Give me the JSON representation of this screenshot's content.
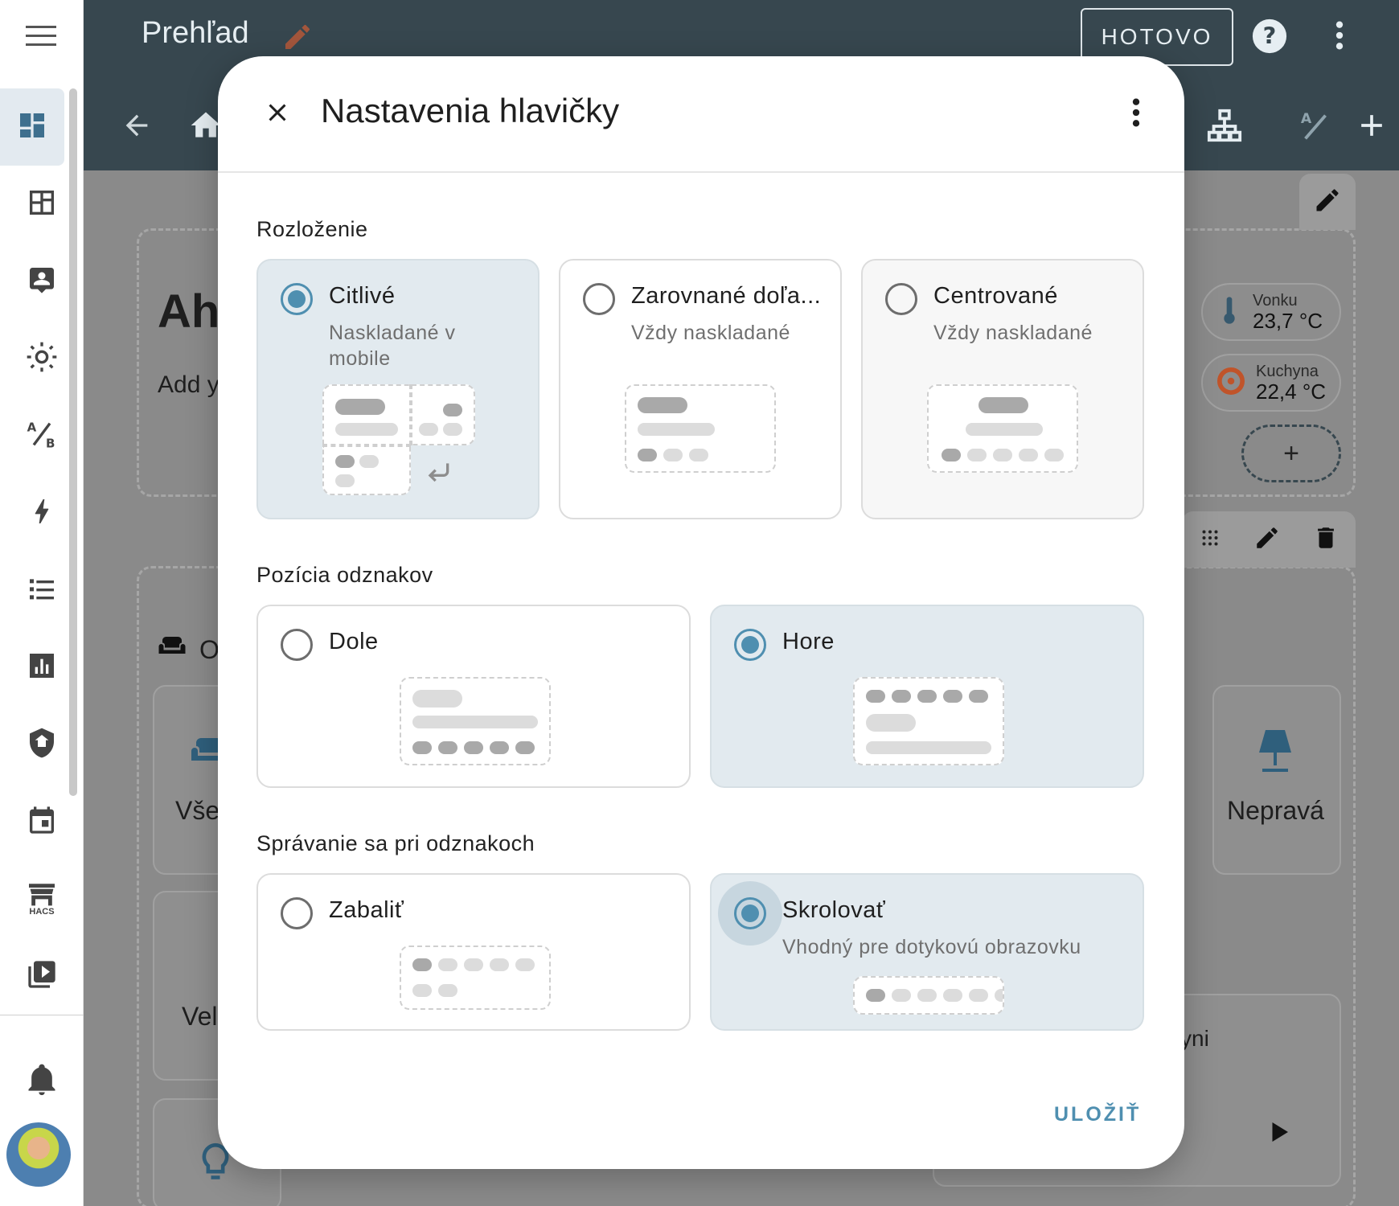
{
  "topbar": {
    "title": "Prehľad",
    "done_label": "HOTOVO"
  },
  "background": {
    "heading": "Ah",
    "subtext": "Add y",
    "area_label": "O",
    "card_all": "Vše",
    "card_vel": "Vel",
    "card_nepr": "Nepravá",
    "partial_text": "yni",
    "chips": [
      {
        "name": "Vonku",
        "value": "23,7 °C"
      },
      {
        "name": "Kuchyna",
        "value": "22,4 °C"
      }
    ],
    "add_chip": "+",
    "hacs_label": "HACS"
  },
  "dialog": {
    "title": "Nastavenia hlavičky",
    "save_label": "ULOŽIŤ",
    "sections": {
      "layout": {
        "label": "Rozloženie",
        "options": [
          {
            "title": "Citlivé",
            "subtitle": "Naskladané v mobile",
            "selected": true
          },
          {
            "title": "Zarovnané doľa...",
            "subtitle": "Vždy naskladané",
            "selected": false
          },
          {
            "title": "Centrované",
            "subtitle": "Vždy naskladané",
            "selected": false
          }
        ]
      },
      "badges_position": {
        "label": "Pozícia odznakov",
        "options": [
          {
            "title": "Dole",
            "selected": false
          },
          {
            "title": "Hore",
            "selected": true
          }
        ]
      },
      "badges_behavior": {
        "label": "Správanie sa pri odznakoch",
        "options": [
          {
            "title": "Zabaliť",
            "selected": false
          },
          {
            "title": "Skrolovať",
            "subtitle": "Vhodný pre dotykovú obrazovku",
            "selected": true
          }
        ]
      }
    }
  },
  "colors": {
    "accent": "#4f8fb0",
    "topbar": "#37474f",
    "selected_bg": "#e2eaef"
  }
}
